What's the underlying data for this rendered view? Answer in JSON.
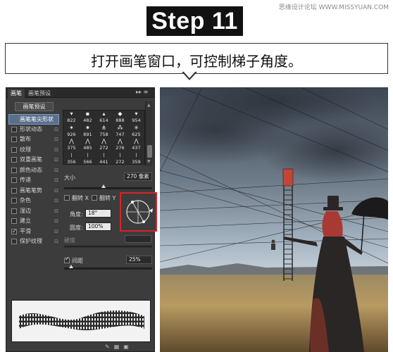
{
  "watermark": "思缘设计论坛 WWW.MISSYUAN.COM",
  "step_label": "Step 11",
  "caption": "打开画笔窗口，可控制梯子角度。",
  "panel": {
    "tabs": [
      "画笔",
      "画笔预设"
    ],
    "tab_controls": "▸▸ ≡",
    "preset_button": "画笔预设",
    "options": [
      {
        "label": "画笔笔尖形状",
        "checkbox": false,
        "selected": true,
        "lock": false
      },
      {
        "label": "形状动态",
        "checkbox": false,
        "selected": false,
        "lock": true
      },
      {
        "label": "散布",
        "checkbox": false,
        "selected": false,
        "lock": true
      },
      {
        "label": "纹理",
        "checkbox": false,
        "selected": false,
        "lock": true
      },
      {
        "label": "双重画笔",
        "checkbox": false,
        "selected": false,
        "lock": true
      },
      {
        "label": "颜色动态",
        "checkbox": false,
        "selected": false,
        "lock": true
      },
      {
        "label": "传递",
        "checkbox": false,
        "selected": false,
        "lock": true
      },
      {
        "label": "画笔笔势",
        "checkbox": false,
        "selected": false,
        "lock": true
      },
      {
        "label": "杂色",
        "checkbox": false,
        "selected": false,
        "lock": true
      },
      {
        "label": "湿边",
        "checkbox": false,
        "selected": false,
        "lock": true
      },
      {
        "label": "建立",
        "checkbox": false,
        "selected": false,
        "lock": true
      },
      {
        "label": "平滑",
        "checkbox": true,
        "selected": false,
        "lock": true
      },
      {
        "label": "保护纹理",
        "checkbox": false,
        "selected": false,
        "lock": true
      }
    ],
    "brush_tips": [
      [
        "822",
        "482",
        "614",
        "888",
        "954"
      ],
      [
        "926",
        "891",
        "758",
        "747",
        "625"
      ],
      [
        "375",
        "485",
        "272",
        "276",
        "437"
      ],
      [
        "356",
        "566",
        "441",
        "272",
        "359"
      ]
    ],
    "size_label": "大小",
    "size_value": "270 像素",
    "size_level": 0.45,
    "flip_x_label": "翻转 X",
    "flip_y_label": "翻转 Y",
    "angle_label": "角度:",
    "angle_value": "18°",
    "roundness_label": "圆度:",
    "roundness_value": "100%",
    "hardness_label": "硬度",
    "spacing_label": "间距",
    "spacing_checked": true,
    "spacing_value": "25%",
    "spacing_level": 0.08,
    "footer_icons": [
      "brush-tool-icon",
      "grid-icon",
      "new-preset-icon"
    ]
  },
  "colors": {
    "step_bg": "#111111",
    "panel_bg": "#3c3c3c",
    "selected_row": "#5a6f8a",
    "highlight_box": "#d8232a",
    "sky_top": "#3d4652",
    "grass": "#b99a62"
  }
}
